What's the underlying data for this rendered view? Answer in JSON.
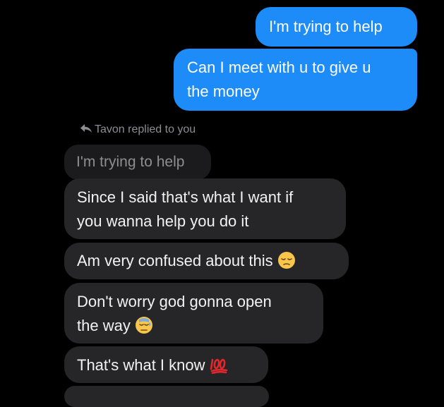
{
  "messages": {
    "sent": [
      {
        "text": "I'm trying to help"
      },
      {
        "line1": "Can I meet with u to give u",
        "line2": "the money"
      }
    ],
    "reply": {
      "label": "Tavon replied to you",
      "quoted": "I'm trying to help"
    },
    "received": [
      {
        "line1": "Since I said that's what I want if",
        "line2": "you wanna help you do it"
      },
      {
        "text": "Am very confused about this",
        "emoji": "pensive-face"
      },
      {
        "line1": "Don't worry god gonna open",
        "line2": "the way",
        "emoji": "downcast-face-with-sweat"
      },
      {
        "text": "That's what I know",
        "emoji": "hundred-points"
      }
    ]
  },
  "colors": {
    "background": "#000000",
    "sent_bubble": "#1d8cf8",
    "received_bubble": "#262628",
    "quoted_bubble": "#1b1b1d",
    "muted_text": "#8d8d92"
  }
}
